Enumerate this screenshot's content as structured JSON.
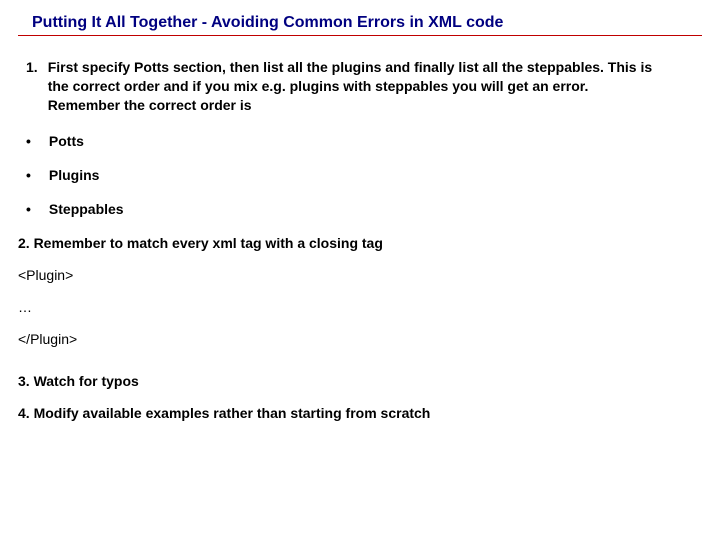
{
  "title": "Putting It All Together - Avoiding Common Errors in XML code",
  "item1": {
    "num": "1.",
    "text": "First specify Potts section, then list all the plugins and finally list all the steppables. This is the correct order and if you mix e.g. plugins with steppables you will get an error. Remember the correct order is"
  },
  "bullets": [
    "Potts",
    "Plugins",
    "Steppables"
  ],
  "item2": "2. Remember to match every xml tag with a closing tag",
  "xml": {
    "open": "<Plugin>",
    "middle": "…",
    "close": "</Plugin>"
  },
  "item3": "3. Watch for typos",
  "item4": "4. Modify available examples rather than starting from scratch"
}
